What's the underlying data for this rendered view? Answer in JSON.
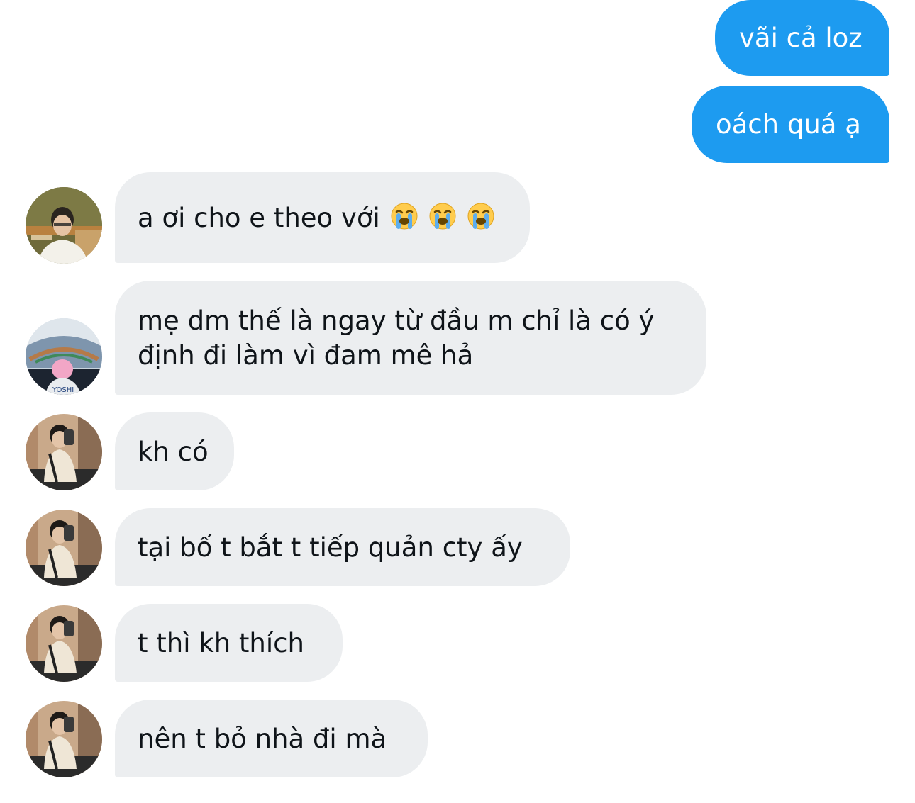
{
  "conversation": {
    "sent": [
      {
        "text": "vãi cả loz"
      },
      {
        "text": "oách quá ạ"
      }
    ],
    "received": [
      {
        "text": "a ơi cho e theo với",
        "emoji": [
          "loudly-crying-face",
          "loudly-crying-face",
          "loudly-crying-face"
        ],
        "avatar": "avatar-user-glasses"
      },
      {
        "text": "mẹ dm thế là ngay từ đầu m chỉ là có ý định đi làm vì đam mê hả",
        "avatar": "avatar-user-stadium"
      },
      {
        "text": "kh có",
        "avatar": "avatar-user-mirror"
      },
      {
        "text": "tại bố t bắt t tiếp quản cty ấy",
        "avatar": "avatar-user-mirror"
      },
      {
        "text": "t thì kh thích",
        "avatar": "avatar-user-mirror"
      },
      {
        "text": "nên t bỏ nhà đi mà",
        "avatar": "avatar-user-mirror"
      }
    ]
  },
  "colors": {
    "sent_bubble": "#1d9bf0",
    "received_bubble": "#eceef0",
    "received_text": "#0f1419"
  }
}
